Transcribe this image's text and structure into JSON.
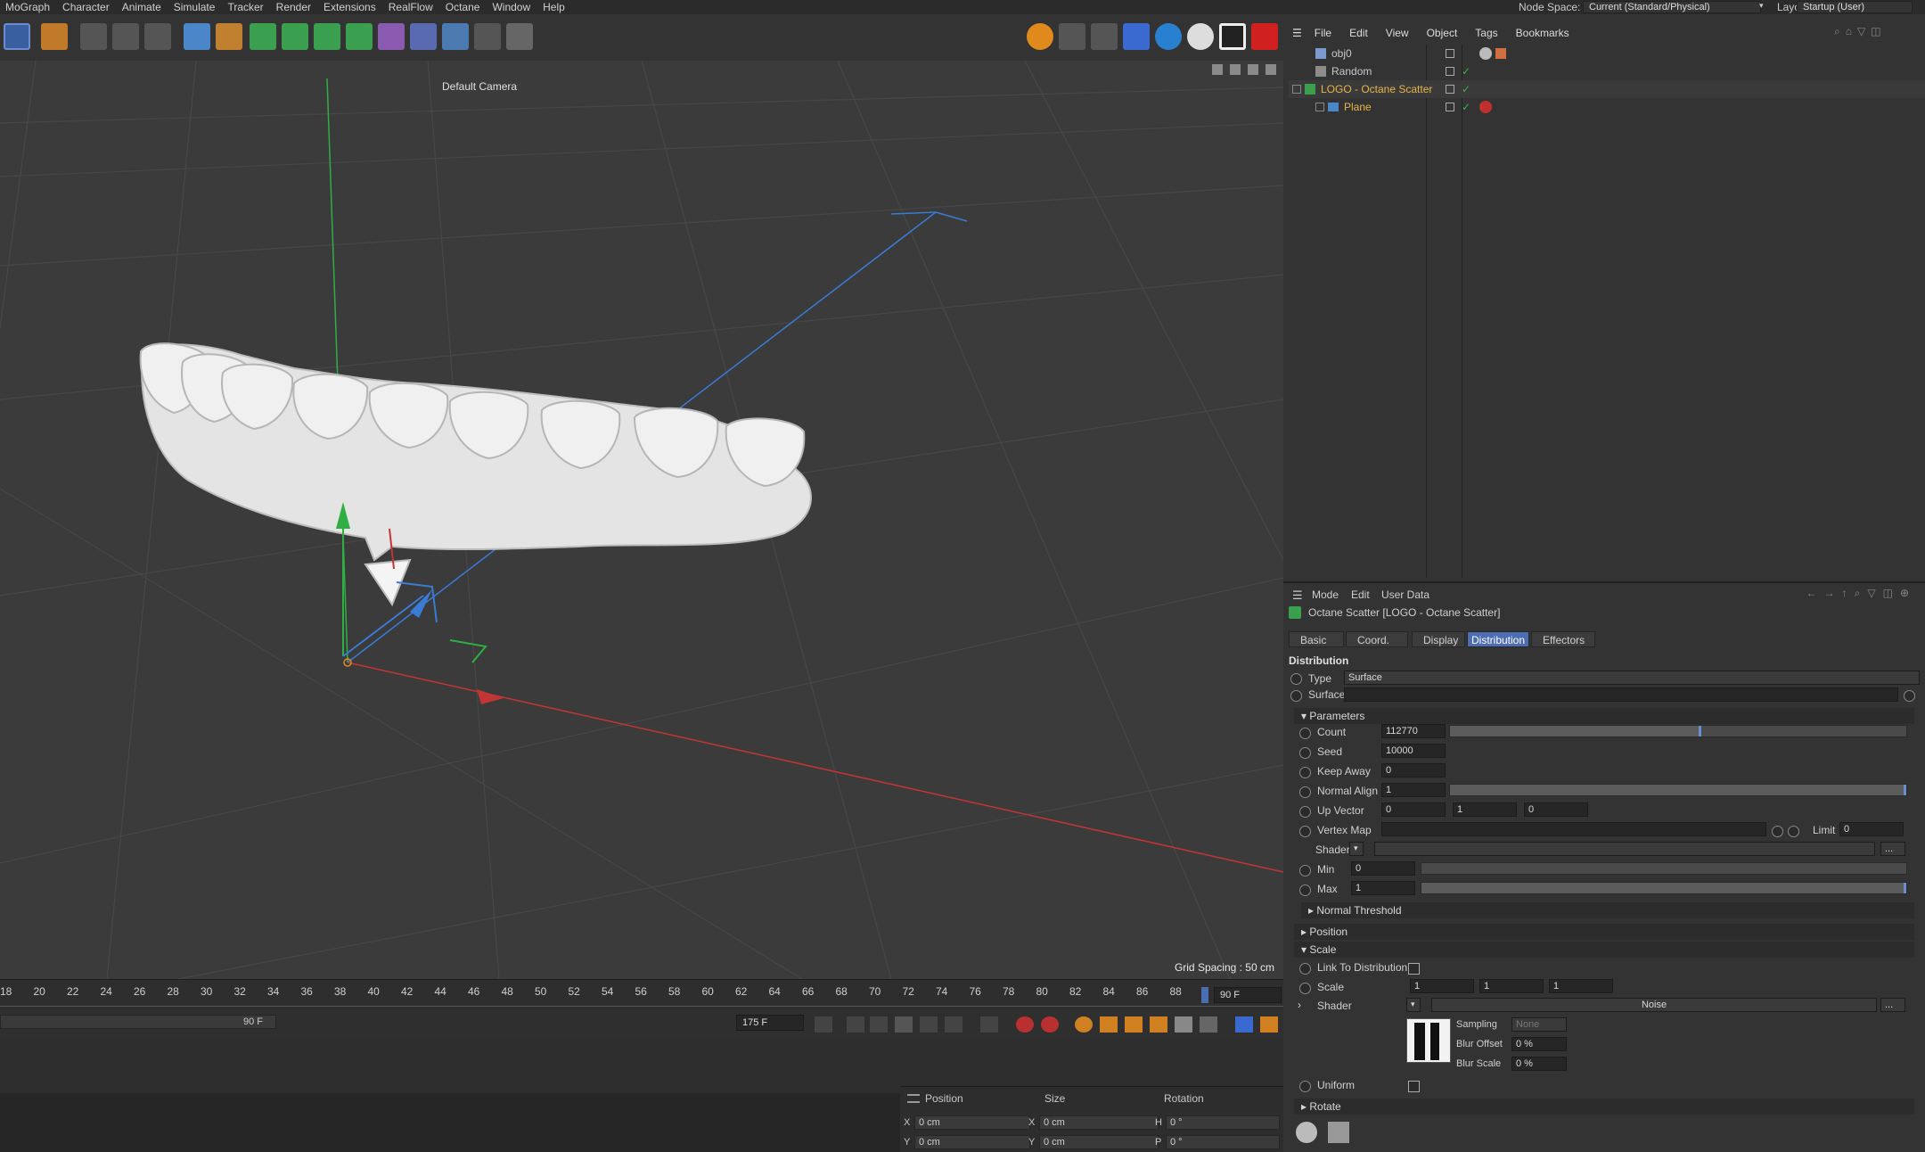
{
  "menubar": [
    "MoGraph",
    "Character",
    "Animate",
    "Simulate",
    "Tracker",
    "Render",
    "Extensions",
    "RealFlow",
    "Octane",
    "Window",
    "Help"
  ],
  "topright": {
    "node_space_label": "Node Space:",
    "node_space_value": "Current (Standard/Physical)",
    "layout_label": "Layout:",
    "layout_value": "Startup (User)"
  },
  "viewport": {
    "camera": "Default Camera",
    "grid_spacing": "Grid Spacing : 50 cm"
  },
  "timeline": {
    "ticks": [
      "18",
      "20",
      "22",
      "24",
      "26",
      "28",
      "30",
      "32",
      "34",
      "36",
      "38",
      "40",
      "42",
      "44",
      "46",
      "48",
      "50",
      "52",
      "54",
      "56",
      "58",
      "60",
      "62",
      "64",
      "66",
      "68",
      "70",
      "72",
      "74",
      "76",
      "78",
      "80",
      "82",
      "84",
      "86",
      "88"
    ],
    "current_frame": "90 F",
    "range_end": "90 F",
    "end_frame": "175 F"
  },
  "coords": {
    "headers": [
      "Position",
      "Size",
      "Rotation"
    ],
    "rows": [
      {
        "a": "X",
        "av": "0 cm",
        "b": "X",
        "bv": "0 cm",
        "c": "H",
        "cv": "0 °"
      },
      {
        "a": "Y",
        "av": "0 cm",
        "b": "Y",
        "bv": "0 cm",
        "c": "P",
        "cv": "0 °"
      }
    ]
  },
  "object_manager": {
    "menu": [
      "File",
      "Edit",
      "View",
      "Object",
      "Tags",
      "Bookmarks"
    ],
    "objects": [
      {
        "name": "obj0",
        "color": "#d0d0d0"
      },
      {
        "name": "Random",
        "color": "#d0d0d0"
      },
      {
        "name": "LOGO - Octane Scatter",
        "color": "#e7b54a"
      },
      {
        "name": "Plane",
        "color": "#e7b54a"
      }
    ]
  },
  "attribute_manager": {
    "menu": [
      "Mode",
      "Edit",
      "User Data"
    ],
    "title": "Octane Scatter [LOGO - Octane Scatter]",
    "tabs": [
      "Basic",
      "Coord.",
      "Display",
      "Distribution",
      "Effectors"
    ],
    "active_tab": "Distribution",
    "section_title": "Distribution",
    "type_label": "Type",
    "type_value": "Surface",
    "surface_label": "Surface",
    "parameters_label": "Parameters",
    "count_label": "Count",
    "count_value": "112770",
    "count_fill": 0.55,
    "seed_label": "Seed",
    "seed_value": "10000",
    "keepaway_label": "Keep Away",
    "keepaway_value": "0",
    "normalalign_label": "Normal Align",
    "normalalign_value": "1",
    "normalalign_fill": 1.0,
    "upvector_label": "Up Vector",
    "upvector_values": [
      "0",
      "1",
      "0"
    ],
    "vertexmap_label": "Vertex Map",
    "limit_label": "Limit",
    "limit_value": "0",
    "shader_label": "Shader",
    "min_label": "Min",
    "min_value": "0",
    "max_label": "Max",
    "max_value": "1",
    "max_fill": 1.0,
    "normal_threshold_label": "Normal Threshold",
    "position_label": "Position",
    "scale_label": "Scale",
    "link_label": "Link To Distribution",
    "scale_field_label": "Scale",
    "scale_values": [
      "1",
      "1",
      "1"
    ],
    "scale_shader_label": "Shader",
    "noise_label": "Noise",
    "sampling_label": "Sampling",
    "sampling_value": "None",
    "blur_offset_label": "Blur Offset",
    "blur_offset_value": "0 %",
    "blur_scale_label": "Blur Scale",
    "blur_scale_value": "0 %",
    "uniform_label": "Uniform",
    "rotate_label": "Rotate"
  },
  "colors": {
    "accent": "#4d6db3",
    "object_highlight": "#e7b54a",
    "axis_x": "#d23a3a",
    "axis_y": "#36b04a",
    "axis_z": "#3a7bd5"
  }
}
